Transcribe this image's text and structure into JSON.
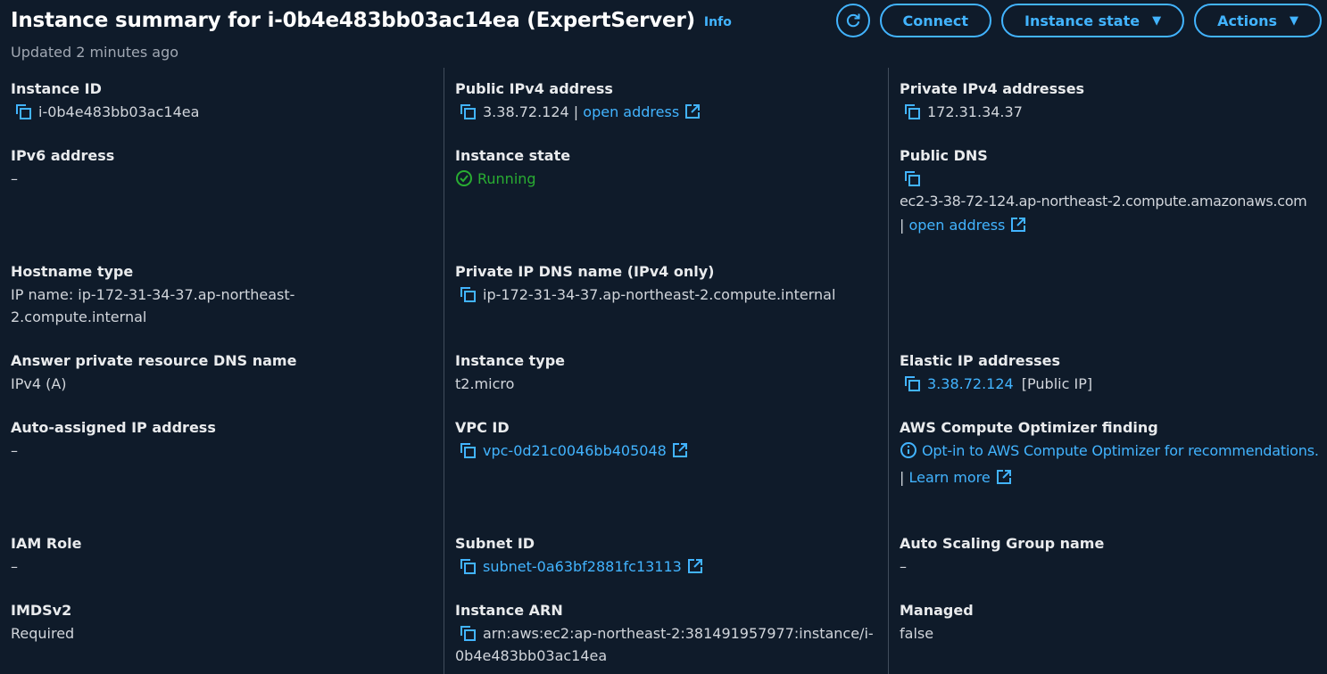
{
  "header": {
    "title": "Instance summary for i-0b4e483bb03ac14ea (ExpertServer)",
    "info_label": "Info",
    "updated": "Updated 2 minutes ago",
    "buttons": {
      "connect": "Connect",
      "instance_state": "Instance state",
      "actions": "Actions"
    }
  },
  "fields": {
    "instance_id": {
      "label": "Instance ID",
      "value": "i-0b4e483bb03ac14ea"
    },
    "ipv6": {
      "label": "IPv6 address",
      "value": "–"
    },
    "hostname_type": {
      "label": "Hostname type",
      "value": "IP name: ip-172-31-34-37.ap-northeast-2.compute.internal"
    },
    "answer_dns": {
      "label": "Answer private resource DNS name",
      "value": "IPv4 (A)"
    },
    "auto_ip": {
      "label": "Auto-assigned IP address",
      "value": "–"
    },
    "iam_role": {
      "label": "IAM Role",
      "value": "–"
    },
    "imdsv2": {
      "label": "IMDSv2",
      "value": "Required"
    },
    "public_ipv4": {
      "label": "Public IPv4 address",
      "value": "3.38.72.124",
      "separator": "|",
      "link": "open address"
    },
    "instance_state": {
      "label": "Instance state",
      "value": "Running"
    },
    "private_dns": {
      "label": "Private IP DNS name (IPv4 only)",
      "value": "ip-172-31-34-37.ap-northeast-2.compute.internal"
    },
    "instance_type": {
      "label": "Instance type",
      "value": "t2.micro"
    },
    "vpc_id": {
      "label": "VPC ID",
      "value": "vpc-0d21c0046bb405048"
    },
    "subnet_id": {
      "label": "Subnet ID",
      "value": "subnet-0a63bf2881fc13113"
    },
    "instance_arn": {
      "label": "Instance ARN",
      "value": "arn:aws:ec2:ap-northeast-2:381491957977:instance/i-0b4e483bb03ac14ea"
    },
    "private_ipv4": {
      "label": "Private IPv4 addresses",
      "value": "172.31.34.37"
    },
    "public_dns": {
      "label": "Public DNS",
      "value": "ec2-3-38-72-124.ap-northeast-2.compute.amazonaws.com",
      "separator": "|",
      "link": "open address"
    },
    "elastic_ip": {
      "label": "Elastic IP addresses",
      "value": "3.38.72.124",
      "suffix": "[Public IP]"
    },
    "optimizer": {
      "label": "AWS Compute Optimizer finding",
      "link": "Opt-in to AWS Compute Optimizer for recommendations.",
      "separator": "|",
      "learn_more": "Learn more"
    },
    "asg_name": {
      "label": "Auto Scaling Group name",
      "value": "–"
    },
    "managed": {
      "label": "Managed",
      "value": "false"
    }
  },
  "colors": {
    "background": "#0f1b2a",
    "link": "#42b4ff",
    "running": "#29ad32",
    "divider": "#414d5c"
  }
}
